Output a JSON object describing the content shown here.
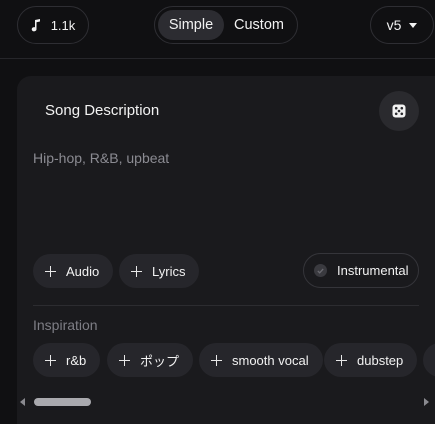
{
  "header": {
    "credits_label": "1.1k",
    "credits_icon": "music-note-icon",
    "modes": [
      {
        "label": "Simple",
        "active": true
      },
      {
        "label": "Custom",
        "active": false
      }
    ],
    "version_label": "v5"
  },
  "song_description": {
    "title": "Song Description",
    "placeholder": "Hip-hop, R&B, upbeat",
    "dice_icon": "dice-icon"
  },
  "actions": {
    "audio_label": "Audio",
    "lyrics_label": "Lyrics",
    "instrumental_label": "Instrumental"
  },
  "inspiration": {
    "label": "Inspiration",
    "tags": [
      "r&b",
      "ポップ",
      "smooth vocal",
      "dubstep"
    ]
  },
  "colors": {
    "background": "#101012",
    "card": "#1a1a1d",
    "chip": "#26262b"
  }
}
